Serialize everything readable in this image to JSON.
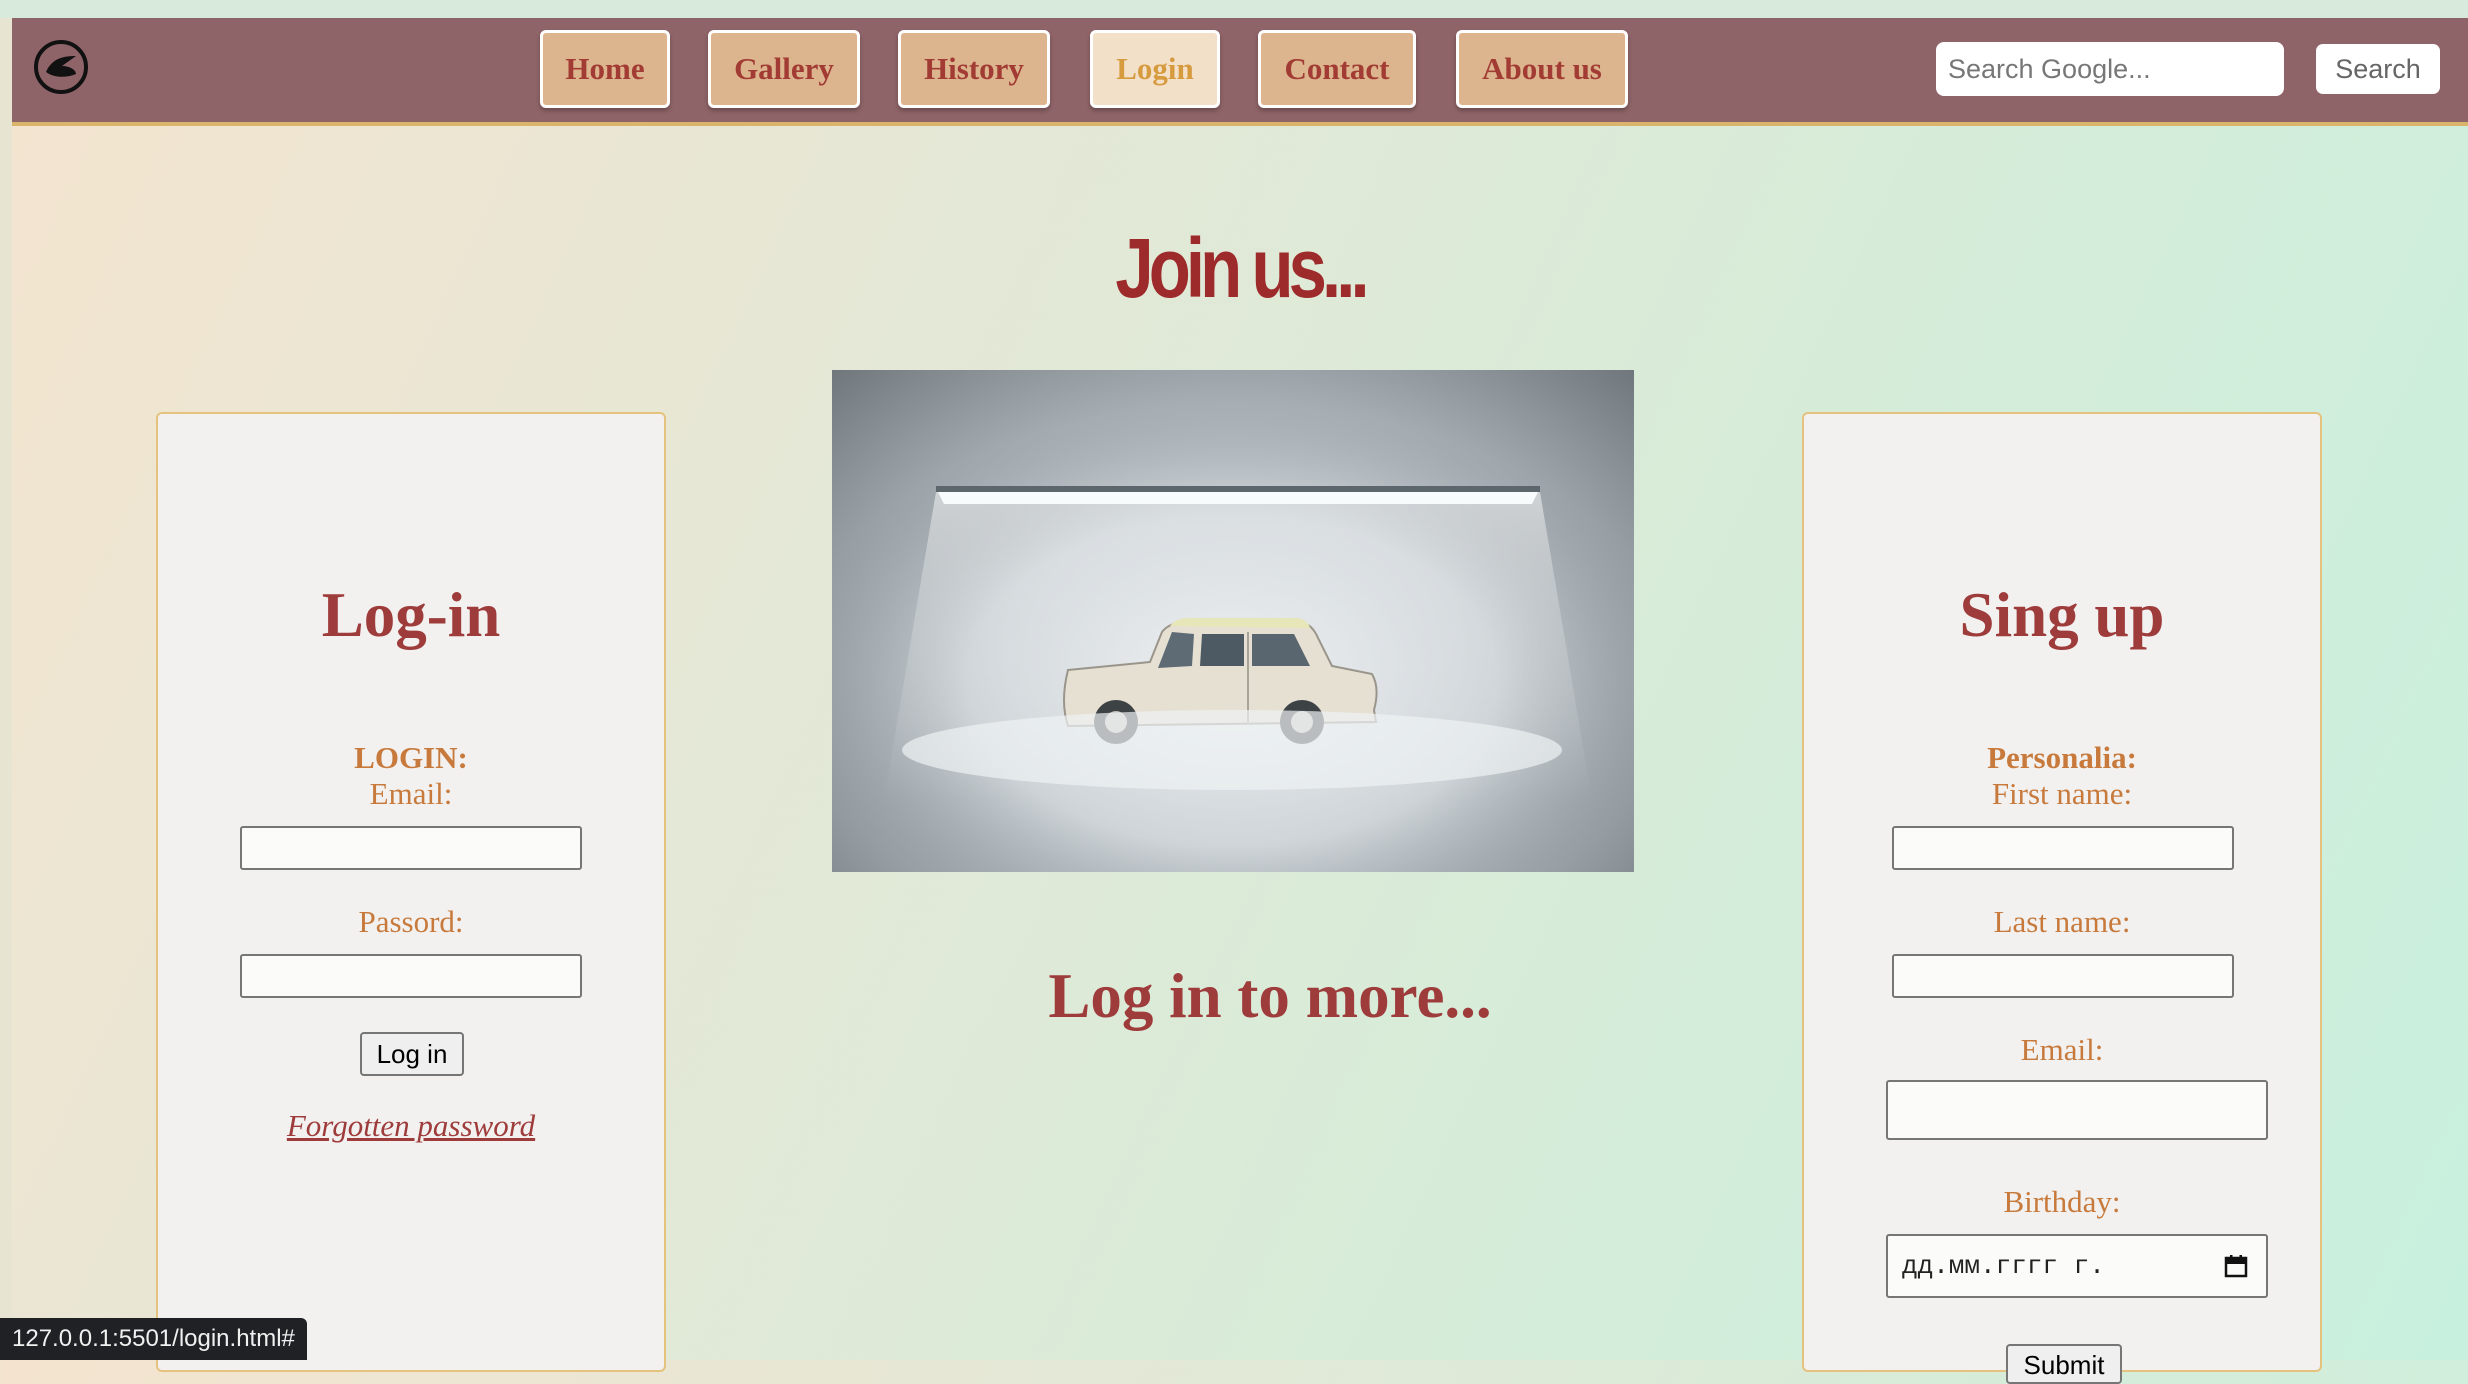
{
  "nav": {
    "items": [
      {
        "label": "Home"
      },
      {
        "label": "Gallery"
      },
      {
        "label": "History"
      },
      {
        "label": "Login"
      },
      {
        "label": "Contact"
      },
      {
        "label": "About us"
      }
    ],
    "active": "Login",
    "search_placeholder": "Search Google...",
    "search_button": "Search"
  },
  "main": {
    "title": "Join us...",
    "subtitle": "Log in to more..."
  },
  "login": {
    "title": "Log-in",
    "section": "LOGIN:",
    "email_label": "Email:",
    "password_label": "Passord:",
    "button": "Log in",
    "forgot": "Forgotten password"
  },
  "signup": {
    "title": "Sing up",
    "section": "Personalia:",
    "first_name_label": "First name:",
    "last_name_label": "Last name:",
    "email_label": "Email:",
    "birthday_label": "Birthday:",
    "birthday_placeholder": "дд.мм.гггг г.",
    "submit": "Submit"
  },
  "status_url": "127.0.0.1:5501/login.html#"
}
